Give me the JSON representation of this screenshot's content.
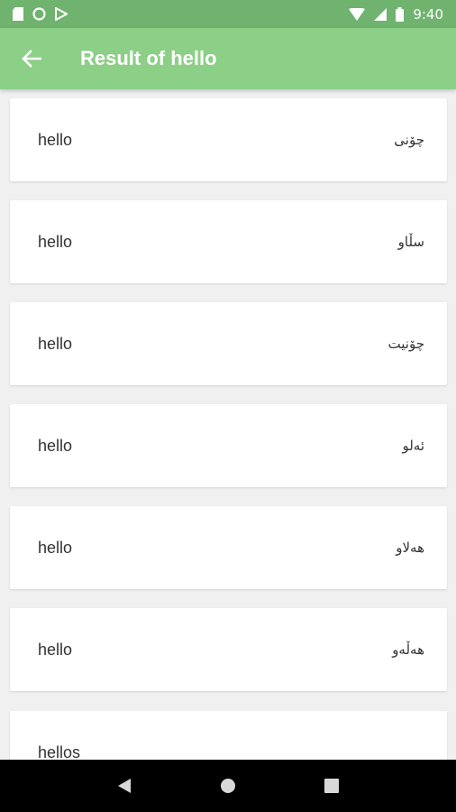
{
  "status_bar": {
    "time": "9:40",
    "left_icons": [
      "sd-card-icon",
      "circle-icon",
      "play-store-icon"
    ],
    "right_icons": [
      "wifi-icon",
      "signal-icon",
      "battery-icon"
    ]
  },
  "app_bar": {
    "title": "Result of hello",
    "background": "#8ccf86"
  },
  "results": [
    {
      "en": "hello",
      "ku": "چۆنی"
    },
    {
      "en": "hello",
      "ku": "سڵاو"
    },
    {
      "en": "hello",
      "ku": "چۆنیت"
    },
    {
      "en": "hello",
      "ku": "ئەلو"
    },
    {
      "en": "hello",
      "ku": "هەلاو"
    },
    {
      "en": "hello",
      "ku": "هەڵەو"
    },
    {
      "en": "hellos",
      "ku": ""
    }
  ],
  "nav_bar": {
    "buttons": [
      "back-triangle-icon",
      "home-circle-icon",
      "recents-square-icon"
    ]
  }
}
